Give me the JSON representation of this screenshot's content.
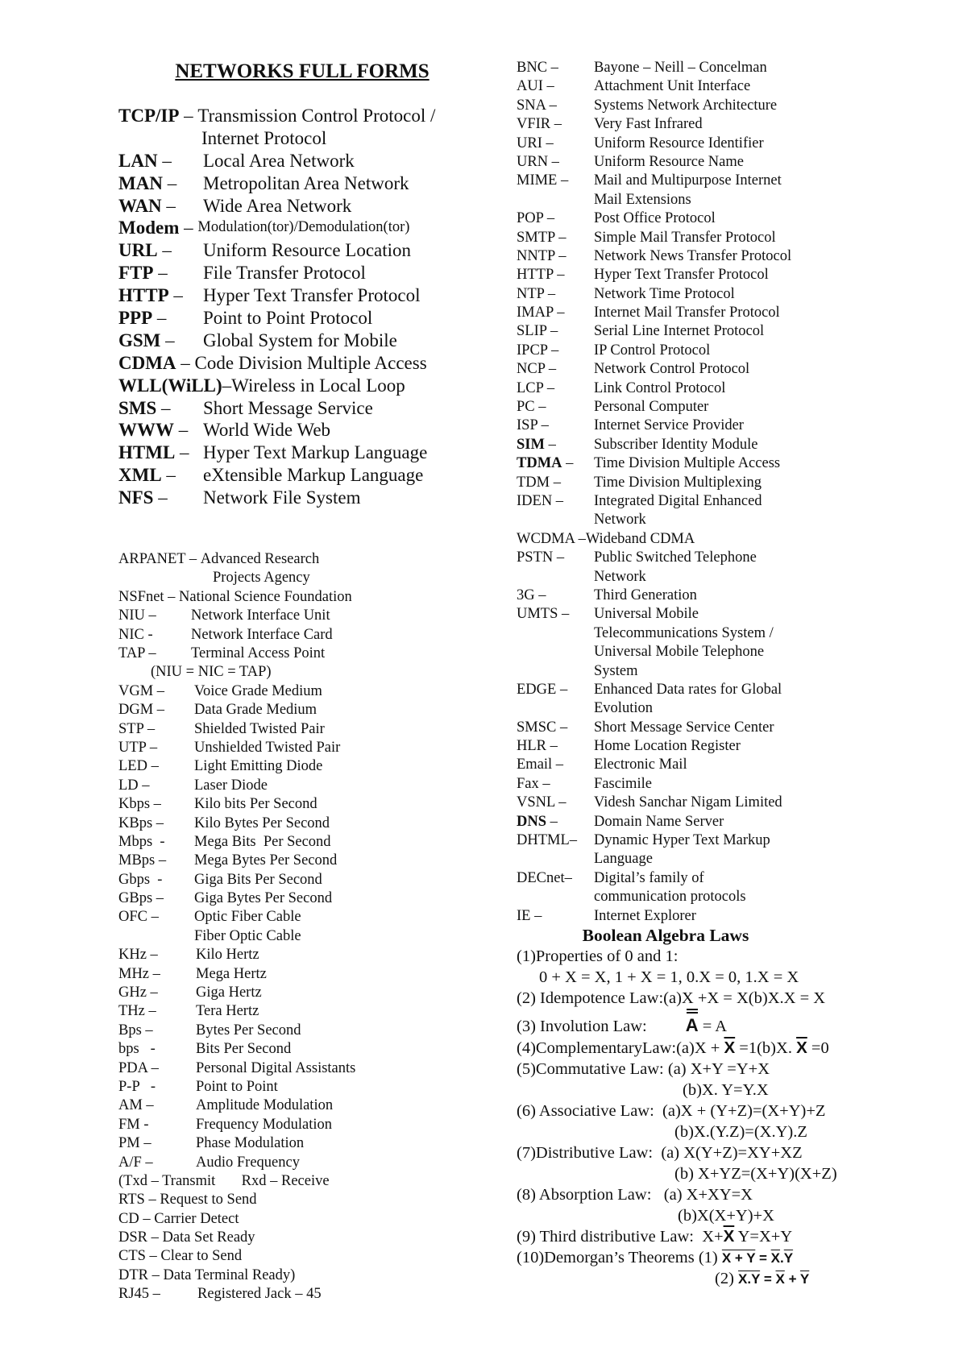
{
  "title": "NETWORKS FULL FORMS",
  "major": [
    {
      "abbr": "TCP/IP",
      "sep": " – ",
      "full": "Transmission Control Protocol /",
      "cont": "Internet Protocol"
    },
    {
      "abbr": "LAN",
      "sep": " –",
      "full": "Local Area Network"
    },
    {
      "abbr": "MAN",
      "sep": " –",
      "full": "Metropolitan Area Network"
    },
    {
      "abbr": "WAN",
      "sep": " –",
      "full": "Wide Area Network"
    },
    {
      "abbr": "Modem",
      "sep": " – ",
      "full": "Modulation(tor)/Demodulation(tor)"
    },
    {
      "abbr": "URL",
      "sep": " –",
      "full": "Uniform Resource Location"
    },
    {
      "abbr": "FTP",
      "sep": " –",
      "full": "File Transfer Protocol"
    },
    {
      "abbr": "HTTP",
      "sep": " –",
      "full": "Hyper Text Transfer Protocol"
    },
    {
      "abbr": "PPP",
      "sep": " –",
      "full": "Point to Point Protocol"
    },
    {
      "abbr": "GSM",
      "sep": " –",
      "full": "Global System for Mobile"
    },
    {
      "abbr": "CDMA",
      "sep": " – ",
      "full": "Code Division Multiple Access"
    },
    {
      "abbr": "WLL(WiLL)",
      "sep": "–",
      "full": "Wireless in Local Loop"
    },
    {
      "abbr": "SMS",
      "sep": " –",
      "full": "Short Message Service"
    },
    {
      "abbr": "WWW",
      "sep": " –",
      "full": "World Wide Web"
    },
    {
      "abbr": "HTML",
      "sep": " –",
      "full": "Hyper Text Markup Language"
    },
    {
      "abbr": "XML",
      "sep": " –",
      "full": "eXtensible Markup Language"
    },
    {
      "abbr": "NFS",
      "sep": " –",
      "full": "Network File System"
    }
  ],
  "left_minor": {
    "arpanet": {
      "abbr": "ARPANET – ",
      "full": "Advanced Research",
      "cont": "Projects Agency"
    },
    "nsfnet": "NSFnet – National Science Foundation",
    "items_a": [
      {
        "abbr": "NIU –",
        "full": "Network Interface Unit"
      },
      {
        "abbr": "NIC -",
        "full": "Network Interface Card"
      },
      {
        "abbr": "TAP –",
        "full": "Terminal Access Point"
      }
    ],
    "note": "(NIU = NIC = TAP)",
    "items_b": [
      {
        "abbr": "VGM –",
        "full": "Voice Grade Medium"
      },
      {
        "abbr": "DGM –",
        "full": "Data Grade Medium"
      },
      {
        "abbr": "STP –",
        "full": "Shielded Twisted Pair"
      },
      {
        "abbr": "UTP –",
        "full": "Unshielded Twisted Pair"
      },
      {
        "abbr": "LED –",
        "full": "Light Emitting Diode"
      },
      {
        "abbr": "LD –",
        "full": "Laser Diode"
      },
      {
        "abbr": "Kbps –",
        "full": "Kilo bits Per Second"
      },
      {
        "abbr": "KBps –",
        "full": "Kilo Bytes Per Second"
      },
      {
        "abbr": "Mbps  -",
        "full": "Mega Bits  Per Second"
      },
      {
        "abbr": "MBps –",
        "full": "Mega Bytes Per Second"
      },
      {
        "abbr": "Gbps  -",
        "full": "Giga Bits Per Second"
      },
      {
        "abbr": "GBps –",
        "full": "Giga Bytes Per Second"
      },
      {
        "abbr": "OFC –",
        "full": "Optic Fiber Cable"
      }
    ],
    "ofc_cont": "Fiber Optic Cable",
    "items_c": [
      {
        "abbr": "KHz –",
        "full": "Kilo Hertz"
      },
      {
        "abbr": "MHz –",
        "full": "Mega Hertz"
      },
      {
        "abbr": "GHz –",
        "full": "Giga Hertz"
      },
      {
        "abbr": "THz –",
        "full": "Tera Hertz"
      },
      {
        "abbr": "Bps –",
        "full": "Bytes Per Second"
      },
      {
        "abbr": "bps   -",
        "full": "Bits Per Second"
      },
      {
        "abbr": "PDA –",
        "full": "Personal Digital Assistants"
      },
      {
        "abbr": "P-P   -",
        "full": "Point to Point"
      },
      {
        "abbr": "AM –",
        "full": "Amplitude Modulation"
      },
      {
        "abbr": "FM -",
        "full": "Frequency Modulation"
      },
      {
        "abbr": "PM –",
        "full": "Phase Modulation"
      },
      {
        "abbr": "A/F –",
        "full": "Audio Frequency"
      }
    ],
    "serial": [
      "(Txd – Transmit       Rxd – Receive",
      "RTS – Request to Send",
      "CD – Carrier Detect",
      "DSR – Data Set Ready",
      "CTS – Clear to Send",
      "DTR – Data Terminal Ready)"
    ],
    "rj45": {
      "abbr": "RJ45 –",
      "full": "Registered Jack – 45"
    }
  },
  "right_list": [
    {
      "abbr": "BNC –",
      "full": "Bayone – Neill – Concelman"
    },
    {
      "abbr": "AUI –",
      "full": "Attachment Unit Interface"
    },
    {
      "abbr": "SNA –",
      "full": "Systems Network Architecture"
    },
    {
      "abbr": "VFIR –",
      "full": "Very Fast Infrared"
    },
    {
      "abbr": "URI –",
      "full": "Uniform Resource Identifier"
    },
    {
      "abbr": "URN –",
      "full": "Uniform Resource Name"
    },
    {
      "abbr": "MIME –",
      "full": "Mail and Multipurpose Internet",
      "cont": [
        "Mail Extensions"
      ]
    },
    {
      "abbr": "POP –",
      "full": "Post Office Protocol"
    },
    {
      "abbr": "SMTP –",
      "full": "Simple Mail Transfer Protocol"
    },
    {
      "abbr": "NNTP –",
      "full": "Network News Transfer Protocol"
    },
    {
      "abbr": "HTTP –",
      "full": "Hyper Text Transfer Protocol"
    },
    {
      "abbr": "NTP –",
      "full": "Network Time Protocol"
    },
    {
      "abbr": "IMAP –",
      "full": "Internet Mail Transfer Protocol"
    },
    {
      "abbr": "SLIP –",
      "full": "Serial Line Internet Protocol"
    },
    {
      "abbr": "IPCP –",
      "full": "IP Control Protocol"
    },
    {
      "abbr": "NCP –",
      "full": "Network Control Protocol"
    },
    {
      "abbr": "LCP –",
      "full": "Link Control Protocol"
    },
    {
      "abbr": "PC –",
      "full": "Personal Computer"
    },
    {
      "abbr": "ISP –",
      "full": "Internet Service Provider"
    },
    {
      "abbr": "SIM",
      "sep": " –",
      "full": "Subscriber Identity Module",
      "bold": true
    },
    {
      "abbr": "TDMA",
      "sep": " –",
      "full": "Time Division Multiple Access",
      "bold": true
    },
    {
      "abbr": "TDM –",
      "full": "Time Division Multiplexing"
    },
    {
      "abbr": "IDEN –",
      "full": "Integrated Digital Enhanced",
      "cont": [
        "Network"
      ]
    },
    {
      "abbr": "WCDMA –",
      "full": "Wideband CDMA",
      "inline": true
    },
    {
      "abbr": "PSTN –",
      "full": "Public Switched Telephone",
      "cont": [
        "Network"
      ]
    },
    {
      "abbr": "3G –",
      "full": "Third Generation"
    },
    {
      "abbr": "UMTS –",
      "full": "Universal Mobile",
      "cont": [
        "Telecommunications System /",
        "Universal Mobile Telephone",
        "System"
      ]
    },
    {
      "abbr": "EDGE –",
      "full": "Enhanced Data rates for Global",
      "cont": [
        "Evolution"
      ]
    },
    {
      "abbr": "SMSC –",
      "full": "Short Message Service Center"
    },
    {
      "abbr": "HLR –",
      "full": "Home Location Register"
    },
    {
      "abbr": "Email –",
      "full": "Electronic Mail"
    },
    {
      "abbr": "Fax –",
      "full": "Fascimile"
    },
    {
      "abbr": "VSNL –",
      "full": "Videsh Sanchar Nigam Limited"
    },
    {
      "abbr": "DNS",
      "sep": " –",
      "full": "Domain Name Server",
      "bold": true
    },
    {
      "abbr": "DHTML–",
      "full": "Dynamic Hyper Text Markup",
      "cont": [
        "Language"
      ]
    },
    {
      "abbr": "DECnet–",
      "full": "Digital’s family of",
      "cont": [
        "communication protocols"
      ]
    },
    {
      "abbr": "IE –",
      "full": "Internet Explorer"
    }
  ],
  "boolean": {
    "title": "Boolean Algebra Laws",
    "l1": "(1)Properties of 0 and 1:",
    "l1b": "0 + X = X, 1 + X = 1, 0.X = 0, 1.X = X",
    "l2": "(2) Idempotence Law:(a)X +X = X(b)X.X = X",
    "l3_label": "(3) Involution Law:",
    "l3_var": "A",
    "l3_rhs": " = A",
    "l4_a": "(4)ComplementaryLaw:(a)X + ",
    "l4_var1": "X",
    "l4_b": " =1(b)X. ",
    "l4_var2": "X",
    "l4_c": " =0",
    "l5a": "(5)Commutative Law: (a) X+Y =Y+X",
    "l5b": "(b)X. Y=Y.X",
    "l6a": "(6) Associative Law:  (a)X + (Y+Z)=(X+Y)+Z",
    "l6b": "(b)X.(Y.Z)=(X.Y).Z",
    "l7a": "(7)Distributive Law:  (a) X(Y+Z)=XY+XZ",
    "l7b": "(b) X+YZ=(X+Y)(X+Z)",
    "l8a": "(8) Absorption Law:   (a) X+XY=X",
    "l8b": "(b)X(X+Y)+X",
    "l9_a": "(9) Third distributive Law:  X+",
    "l9_var": "X",
    "l9_b": " Y=X+Y",
    "l10_label": "(10)Demorgan’s Theorems (1) ",
    "l10_1_lhs": "X + Y",
    "l10_1_eq": " = ",
    "l10_1_x": "X",
    "l10_1_dot": ".",
    "l10_1_y": "Y",
    "l10_2_label": "(2) ",
    "l10_2_lhs": "X.Y",
    "l10_2_eq": " = ",
    "l10_2_x": "X",
    "l10_2_plus": " + ",
    "l10_2_y": "Y"
  }
}
